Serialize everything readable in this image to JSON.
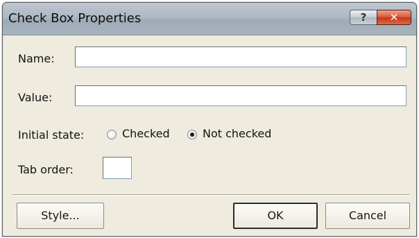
{
  "window": {
    "title": "Check Box Properties",
    "help_label": "?",
    "close_label": "✕"
  },
  "fields": {
    "name_label": "Name:",
    "name_value": "",
    "value_label": "Value:",
    "value_value": "",
    "initial_state_label": "Initial state:",
    "options": [
      {
        "label": "Checked",
        "selected": false
      },
      {
        "label": "Not checked",
        "selected": true
      }
    ],
    "tab_order_label": "Tab order:",
    "tab_order_value": ""
  },
  "buttons": {
    "style_label": "Style...",
    "ok_label": "OK",
    "cancel_label": "Cancel"
  }
}
